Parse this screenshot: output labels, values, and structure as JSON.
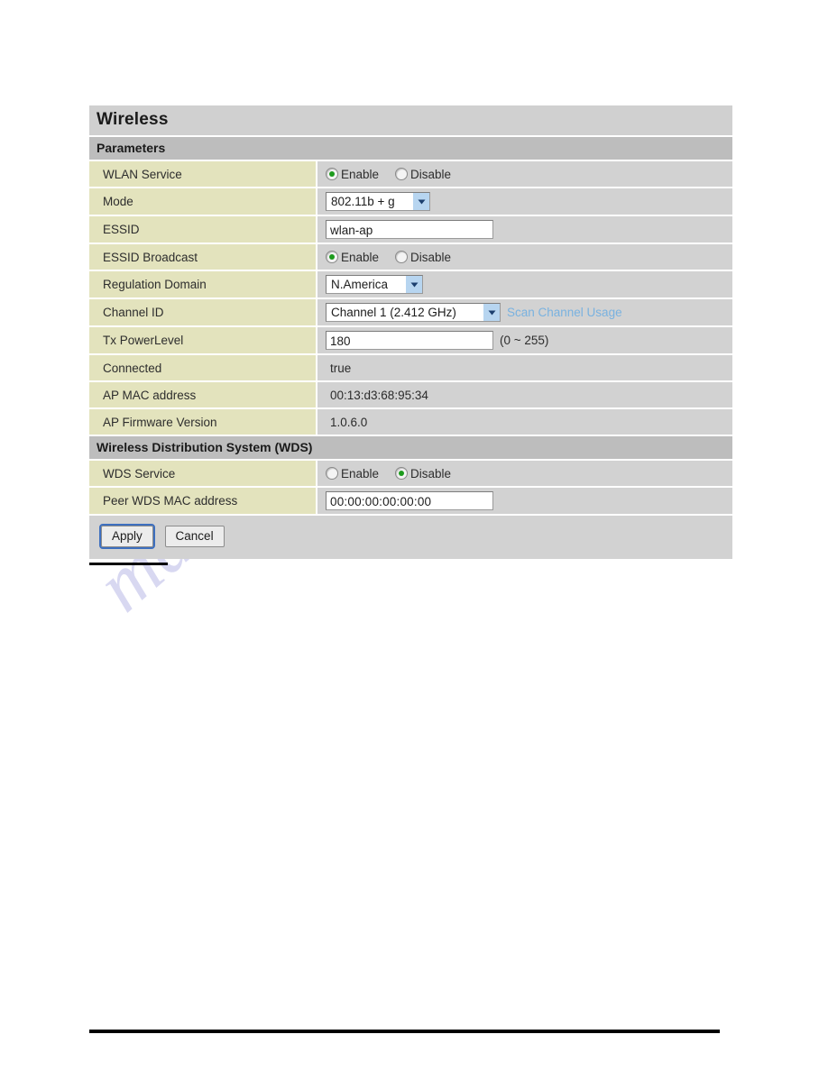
{
  "page": {
    "title": "Wireless"
  },
  "watermark": {
    "text": "manualshive.com"
  },
  "colors": {
    "label_bg": "#e3e3bd",
    "value_bg": "#d2d2d2",
    "title_bg": "#d0d0d0",
    "section_bg": "#bdbdbd",
    "radio_on": "#1d9b1d",
    "link": "#79b2e0",
    "select_arrow_bg": "#b7d5f0",
    "focus_ring": "#3d6fbf"
  },
  "sections": [
    {
      "heading": "Parameters",
      "rows": [
        {
          "label": "WLAN Service",
          "type": "radio",
          "options": [
            "Enable",
            "Disable"
          ],
          "selected": "Enable"
        },
        {
          "label": "Mode",
          "type": "select",
          "value": "802.11b + g"
        },
        {
          "label": "ESSID",
          "type": "text",
          "value": "wlan-ap",
          "placeholder": ""
        },
        {
          "label": "ESSID Broadcast",
          "type": "radio",
          "options": [
            "Enable",
            "Disable"
          ],
          "selected": "Enable"
        },
        {
          "label": "Regulation Domain",
          "type": "select",
          "value": "N.America"
        },
        {
          "label": "Channel ID",
          "type": "select-link",
          "value": "Channel 1 (2.412 GHz)",
          "link": "Scan Channel Usage"
        },
        {
          "label": "Tx PowerLevel",
          "type": "text-hint",
          "value": "180",
          "placeholder": "",
          "hint": "(0 ~ 255)"
        },
        {
          "label": "Connected",
          "type": "static",
          "value": "true"
        },
        {
          "label": "AP MAC address",
          "type": "static",
          "value": "00:13:d3:68:95:34"
        },
        {
          "label": "AP Firmware Version",
          "type": "static",
          "value": "1.0.6.0"
        }
      ]
    },
    {
      "heading": "Wireless Distribution System (WDS)",
      "rows": [
        {
          "label": "WDS Service",
          "type": "radio",
          "options": [
            "Enable",
            "Disable"
          ],
          "selected": "Disable"
        },
        {
          "label": "Peer WDS MAC address",
          "type": "text",
          "value": "00:00:00:00:00:00",
          "placeholder": ""
        }
      ]
    }
  ],
  "buttons": {
    "apply": "Apply",
    "cancel": "Cancel"
  }
}
